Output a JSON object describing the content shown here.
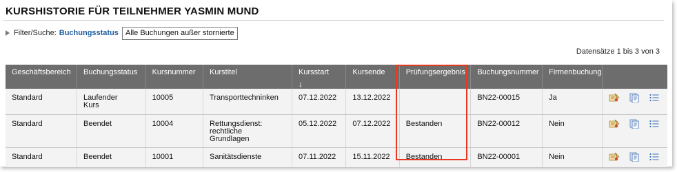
{
  "page": {
    "title": "KURSHISTORIE FÜR TEILNEHMER YASMIN MUND"
  },
  "filter": {
    "label": "Filter/Suche:",
    "field": "Buchungsstatus",
    "value": "Alle Buchungen außer stornierte"
  },
  "records_info": "Datensätze 1 bis 3 von 3",
  "table": {
    "headers": [
      "Geschäftsbereich",
      "Buchungsstatus",
      "Kursnummer",
      "Kurstitel",
      "Kursstart",
      "Kursende",
      "Prüfungsergebnis",
      "Buchungsnummer",
      "Firmenbuchung"
    ],
    "sort_indicator": "↓",
    "rows": [
      {
        "geschaeftsbereich": "Standard",
        "buchungsstatus": "Laufender Kurs",
        "kursnummer": "10005",
        "kurstitel": "Transporttechninken",
        "kursstart": "07.12.2022",
        "kursende": "13.12.2022",
        "pruefungsergebnis": "",
        "buchungsnummer": "BN22-00015",
        "firmenbuchung": "Ja"
      },
      {
        "geschaeftsbereich": "Standard",
        "buchungsstatus": "Beendet",
        "kursnummer": "10004",
        "kurstitel": "Rettungsdienst: rechtliche Grundlagen",
        "kursstart": "05.12.2022",
        "kursende": "07.12.2022",
        "pruefungsergebnis": "Bestanden",
        "buchungsnummer": "BN22-00012",
        "firmenbuchung": "Nein"
      },
      {
        "geschaeftsbereich": "Standard",
        "buchungsstatus": "Beendet",
        "kursnummer": "10001",
        "kurstitel": "Sanitätsdienste",
        "kursstart": "07.11.2022",
        "kursende": "15.11.2022",
        "pruefungsergebnis": "Bestanden",
        "buchungsnummer": "BN22-00001",
        "firmenbuchung": "Nein"
      }
    ],
    "row_action_icons": [
      "certificate-icon",
      "document-icon",
      "list-icon"
    ]
  },
  "colors": {
    "header_bg": "#6d6d6d",
    "row_bg": "#f3f3f3",
    "filter_field": "#1f5fa0",
    "highlight_border": "#e8381f"
  }
}
